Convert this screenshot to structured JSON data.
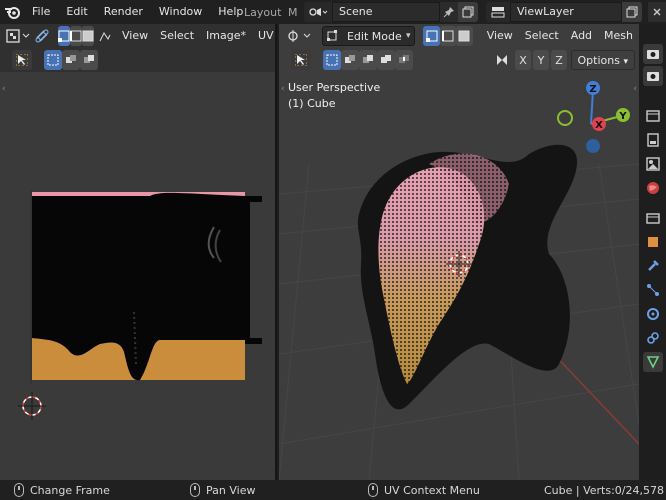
{
  "topbar": {
    "menus": [
      "File",
      "Edit",
      "Render",
      "Window",
      "Help"
    ],
    "workspace_tab": "Layout",
    "workspace_tab_next": "M",
    "scene_name": "Scene",
    "view_layer_name": "ViewLayer"
  },
  "uv_editor": {
    "menus": [
      "View",
      "Select",
      "Image*",
      "UV"
    ]
  },
  "viewport": {
    "mode": "Edit Mode",
    "menus": [
      "View",
      "Select",
      "Add",
      "Mesh"
    ],
    "axis_labels": [
      "X",
      "Y",
      "Z"
    ],
    "options_label": "Options",
    "perspective_label": "User Perspective",
    "object_label": "(1) Cube",
    "gizmo": {
      "z": "Z",
      "y": "Y",
      "x": "X"
    }
  },
  "status": {
    "left": "Change Frame",
    "middle": "Pan View",
    "right_context": "UV Context Menu",
    "stats": "Cube | Verts:0/24,578"
  },
  "colors": {
    "accent_blue": "#4772b3",
    "uv_orange": "#c98d3c",
    "uv_pink": "#e896a8",
    "gizmo_red": "#e0434f",
    "gizmo_green": "#8cbf2f",
    "gizmo_blue": "#3f7fd9"
  }
}
